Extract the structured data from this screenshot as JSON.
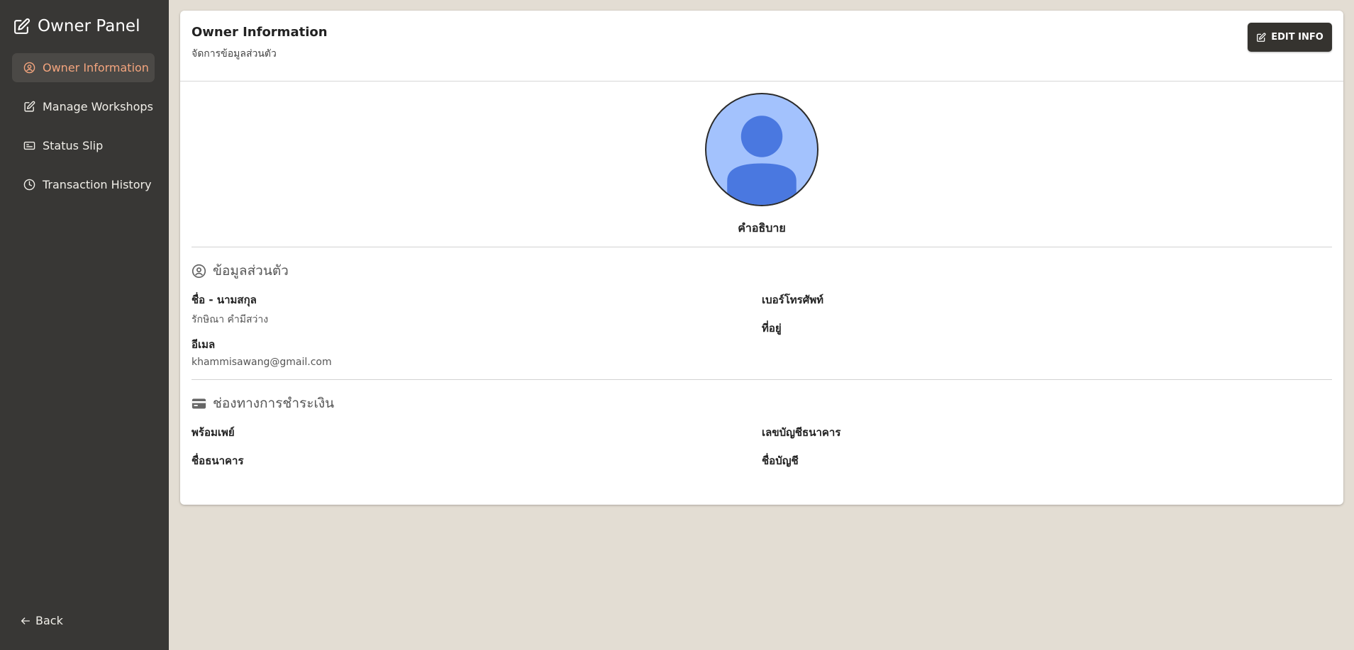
{
  "sidebar": {
    "title": "Owner Panel",
    "title_icon": "edit-square-icon",
    "items": [
      {
        "label": "Owner Information",
        "icon": "user-circle-icon",
        "active": true
      },
      {
        "label": "Manage Workshops",
        "icon": "edit-square-icon",
        "active": false
      },
      {
        "label": "Status Slip",
        "icon": "id-card-icon",
        "active": false
      },
      {
        "label": "Transaction History",
        "icon": "clock-icon",
        "active": false
      }
    ],
    "back_label": "Back"
  },
  "header": {
    "title": "Owner Information",
    "subtitle": "จัดการข้อมูลส่วนตัว",
    "edit_button": "EDIT INFO"
  },
  "profile": {
    "avatar_icon": "user-placeholder-icon",
    "description": "คำอธิบาย"
  },
  "personal": {
    "heading": "ข้อมูลส่วนตัว",
    "name_label": "ชื่อ - นามสกุล",
    "name_value": "รักษิณา คำมีสว่าง",
    "email_label": "อีเมล",
    "email_value": "khammisawang@gmail.com",
    "phone_label": "เบอร์โทรศัพท์",
    "address_label": "ที่อยู่"
  },
  "payment": {
    "heading": "ช่องทางการชำระเงิน",
    "promptpay_label": "พร้อมเพย์",
    "account_number_label": "เลขบัญชีธนาคาร",
    "bank_name_label": "ชื่อธนาคาร",
    "account_name_label": "ชื่อบัญชี"
  },
  "colors": {
    "sidebar_bg": "#383735",
    "active_text": "#f4a57e",
    "page_bg": "#e3ddd3",
    "button_bg": "#35332f",
    "avatar_bg": "#a3c2fd",
    "avatar_figure": "#4a78e0"
  }
}
